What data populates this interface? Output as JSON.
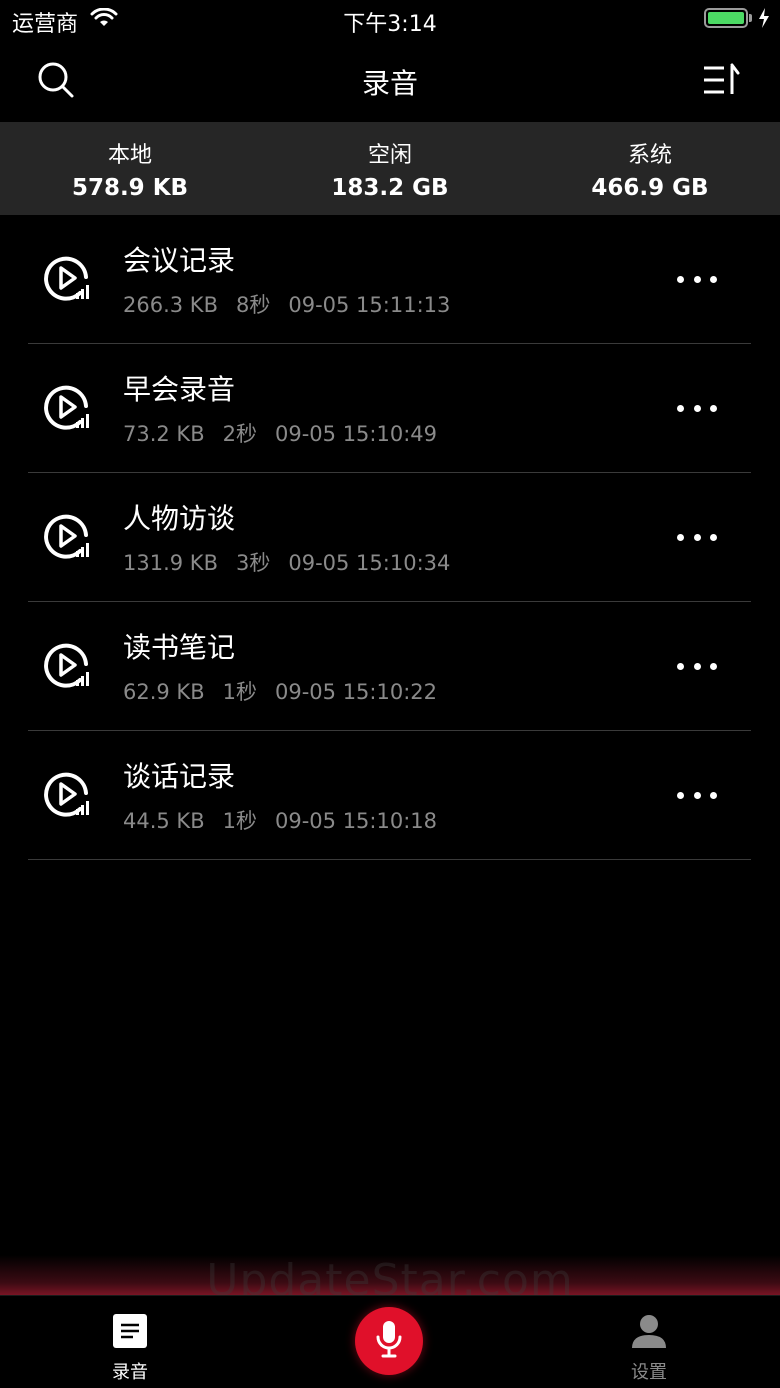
{
  "status_bar": {
    "carrier": "运营商",
    "time": "下午3:14"
  },
  "nav": {
    "title": "录音"
  },
  "storage": [
    {
      "label": "本地",
      "value": "578.9 KB"
    },
    {
      "label": "空闲",
      "value": "183.2 GB"
    },
    {
      "label": "系统",
      "value": "466.9 GB"
    }
  ],
  "recordings": [
    {
      "title": "会议记录",
      "size": "266.3 KB",
      "duration": "8秒",
      "date": "09-05 15:11:13"
    },
    {
      "title": "早会录音",
      "size": "73.2 KB",
      "duration": "2秒",
      "date": "09-05 15:10:49"
    },
    {
      "title": "人物访谈",
      "size": "131.9 KB",
      "duration": "3秒",
      "date": "09-05 15:10:34"
    },
    {
      "title": "读书笔记",
      "size": "62.9 KB",
      "duration": "1秒",
      "date": "09-05 15:10:22"
    },
    {
      "title": "谈话记录",
      "size": "44.5 KB",
      "duration": "1秒",
      "date": "09-05 15:10:18"
    }
  ],
  "watermark": "UpdateStar.com",
  "tabs": {
    "recordings_label": "录音",
    "settings_label": "设置"
  },
  "colors": {
    "accent": "#e0102a",
    "background": "#000000",
    "panel": "#262626",
    "battery": "#4cd964",
    "meta_text": "#8a8a8a"
  },
  "icons": [
    "search-icon",
    "sort-icon",
    "play-audio-icon",
    "more-icon",
    "document-icon",
    "microphone-icon",
    "person-icon",
    "wifi-icon",
    "battery-icon"
  ]
}
